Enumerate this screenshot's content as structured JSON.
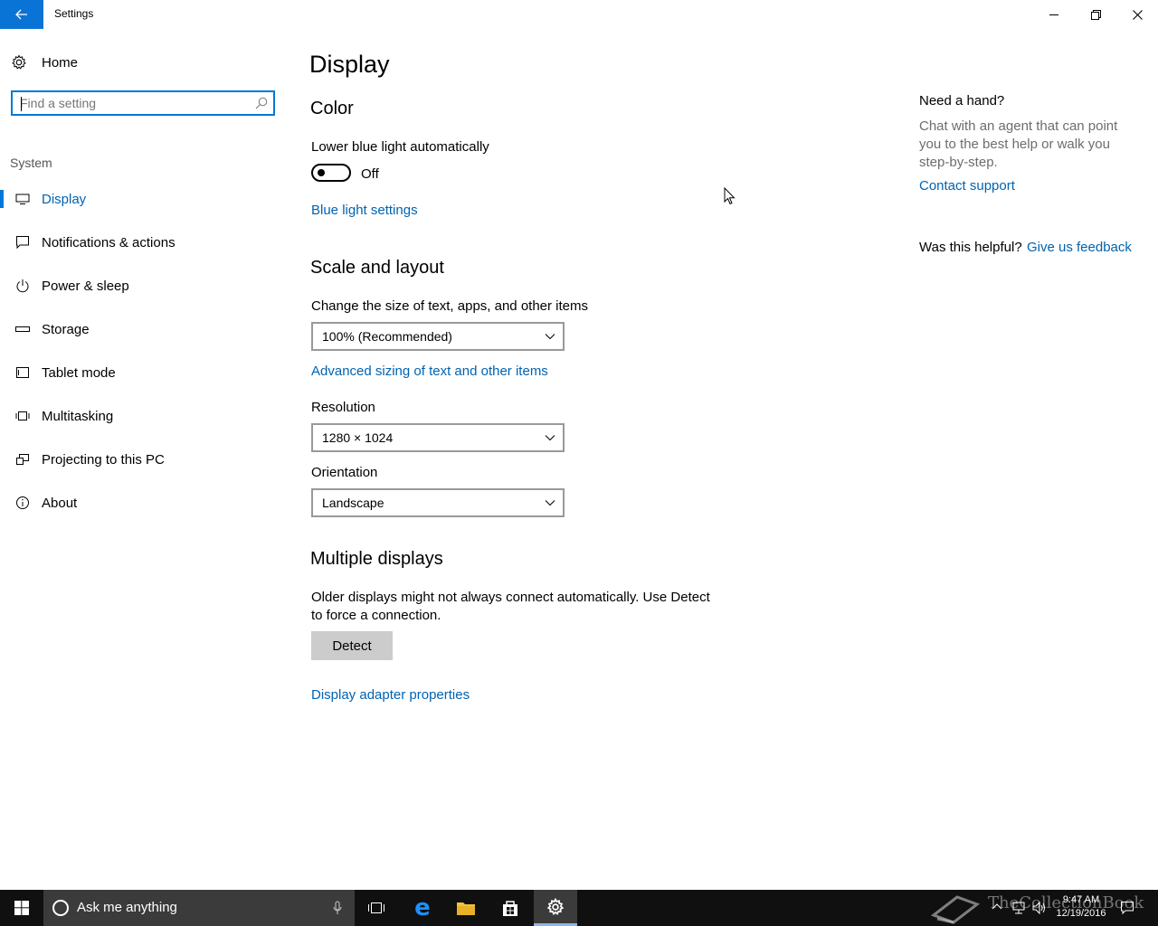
{
  "window": {
    "title": "Settings",
    "controls": [
      "minimize-icon",
      "restore-icon",
      "close-icon"
    ]
  },
  "sidebar": {
    "home_label": "Home",
    "search_placeholder": "Find a setting",
    "section_label": "System",
    "items": [
      {
        "label": "Display",
        "icon": "monitor-icon",
        "selected": true
      },
      {
        "label": "Notifications & actions",
        "icon": "speech-bubble-icon",
        "selected": false
      },
      {
        "label": "Power & sleep",
        "icon": "power-icon",
        "selected": false
      },
      {
        "label": "Storage",
        "icon": "drive-icon",
        "selected": false
      },
      {
        "label": "Tablet mode",
        "icon": "tablet-icon",
        "selected": false
      },
      {
        "label": "Multitasking",
        "icon": "multitasking-icon",
        "selected": false
      },
      {
        "label": "Projecting to this PC",
        "icon": "projecting-icon",
        "selected": false
      },
      {
        "label": "About",
        "icon": "info-icon",
        "selected": false
      }
    ]
  },
  "main": {
    "page_title": "Display",
    "color": {
      "heading": "Color",
      "toggle_label": "Lower blue light automatically",
      "toggle_state": "Off",
      "link": "Blue light settings"
    },
    "scale": {
      "heading": "Scale and layout",
      "size_label": "Change the size of text, apps, and other items",
      "size_value": "100% (Recommended)",
      "advanced_link": "Advanced sizing of text and other items",
      "resolution_label": "Resolution",
      "resolution_value": "1280 × 1024",
      "orientation_label": "Orientation",
      "orientation_value": "Landscape"
    },
    "multiple": {
      "heading": "Multiple displays",
      "desc_line1": "Older displays might not always connect automatically. Use Detect",
      "desc_line2": "to force a connection.",
      "detect_button": "Detect",
      "adapter_link": "Display adapter properties"
    }
  },
  "help": {
    "title": "Need a hand?",
    "desc": "Chat with an agent that can point you to the best help or walk you step-by-step.",
    "contact_link": "Contact support",
    "helpful_label": "Was this helpful?",
    "feedback_link": "Give us feedback"
  },
  "taskbar": {
    "search_placeholder": "Ask me anything",
    "time": "9:47 AM",
    "date": "12/19/2016",
    "watermark": "TheCollectionBook",
    "accent": "#0078d7"
  }
}
